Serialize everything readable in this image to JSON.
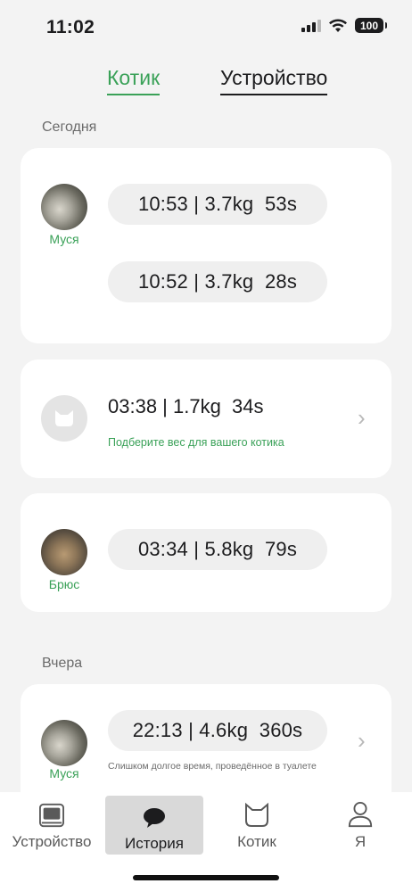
{
  "status_bar": {
    "time": "11:02",
    "battery": "100",
    "icons": [
      "signal-icon",
      "wifi-icon",
      "battery-icon"
    ]
  },
  "top_tabs": [
    {
      "label": "Котик",
      "active": true
    },
    {
      "label": "Устройство",
      "active": false
    }
  ],
  "sections": {
    "today": "Сегодня",
    "yesterday": "Вчера"
  },
  "records": {
    "card1": {
      "cat_name": "Муся",
      "entries": [
        "10:53 | 3.7kg  53s",
        "10:52 | 3.7kg  28s"
      ]
    },
    "card2": {
      "entry": "03:38 | 1.7kg  34s",
      "hint": "Подберите вес для вашего котика"
    },
    "card3": {
      "cat_name": "Брюс",
      "entry": "03:34 | 5.8kg  79s"
    },
    "card4": {
      "cat_name": "Муся",
      "entry": "22:13 | 4.6kg  360s",
      "hint": "Слишком долгое время, проведённое в туалете"
    }
  },
  "tab_bar": [
    {
      "label": "Устройство",
      "icon": "device-icon"
    },
    {
      "label": "История",
      "icon": "chat-bubble-icon",
      "selected": true
    },
    {
      "label": "Котик",
      "icon": "cat-icon"
    },
    {
      "label": "Я",
      "icon": "person-icon"
    }
  ],
  "colors": {
    "accent": "#3aa158",
    "background": "#f3f3f3",
    "card": "#ffffff",
    "pill": "#efefef"
  }
}
